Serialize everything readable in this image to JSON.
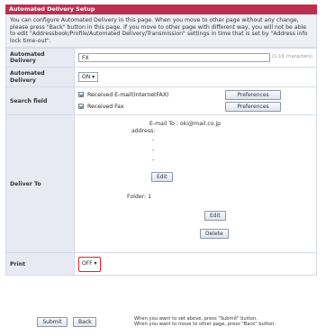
{
  "panel": {
    "title": "Automated Delivery Setup",
    "intro": "You can configure Automated Delivery in this page. When you move to other page without any change, please press \"Back\" button in this page. If you move to other page with different way, you will not be able to edit \"Addressbook/Profile/Automated Delivery/Transmission\" settings in time that is set by \"Address info lock time-out\"."
  },
  "automated_delivery_name": {
    "label": "Automated Delivery",
    "value": "FX",
    "hint": "(1-16 characters)"
  },
  "automated_delivery_toggle": {
    "label": "Automated Delivery",
    "value": "ON"
  },
  "search_field": {
    "label": "Search field",
    "email_checkbox_label": "Received E-mail(InternetFAX)",
    "fax_checkbox_label": "Received Fax",
    "preferences_label": "Preferences"
  },
  "deliver_to": {
    "label": "Deliver To",
    "email_line": "E-mail To : oki@mail.co.jp",
    "address_label": "address:",
    "bullet": "-",
    "edit_label": "Edit",
    "folder_line": "Folder: 1",
    "delete_label": "Delete"
  },
  "print": {
    "label": "Print",
    "value": "OFF"
  },
  "footer": {
    "submit_label": "Submit",
    "back_label": "Back",
    "note_line1": "When you want to set above, press \"Submit\" button.",
    "note_line2": "When you want to move to other page, press \"Back\" button."
  },
  "colors": {
    "title_bar": "#bd2f4f",
    "label_cell": "#e7eaf3",
    "highlight": "#e0202a"
  },
  "icons": {
    "dropdown": "triangle-down-icon",
    "checkbox": "checkmark-icon"
  }
}
